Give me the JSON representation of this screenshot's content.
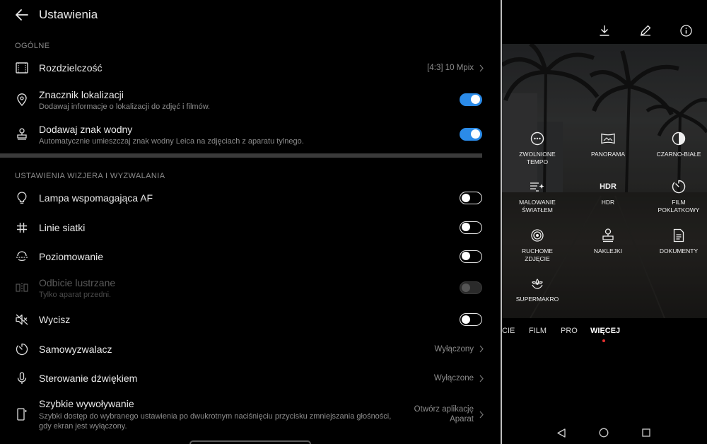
{
  "settings": {
    "title": "Ustawienia",
    "sections": {
      "general": "OGÓLNE",
      "viewfinder": "USTAWIENIA WIZJERA I WYZWALANIA"
    },
    "resolution": {
      "label": "Rozdzielczość",
      "value": "[4:3] 10 Mpix"
    },
    "location": {
      "label": "Znacznik lokalizacji",
      "sub": "Dodawaj informacje o lokalizacji do zdjęć i filmów.",
      "on": true
    },
    "watermark": {
      "label": "Dodawaj znak wodny",
      "sub": "Automatycznie umieszczaj znak wodny Leica na zdjęciach z aparatu tylnego.",
      "on": true
    },
    "af_lamp": {
      "label": "Lampa wspomagająca AF",
      "on": false
    },
    "grid": {
      "label": "Linie siatki",
      "on": false
    },
    "level": {
      "label": "Poziomowanie",
      "on": false
    },
    "mirror": {
      "label": "Odbicie lustrzane",
      "sub": "Tylko aparat przedni.",
      "on": false,
      "disabled": true
    },
    "mute": {
      "label": "Wycisz",
      "on": false
    },
    "timer": {
      "label": "Samowyzwalacz",
      "value": "Wyłączony"
    },
    "voice": {
      "label": "Sterowanie dźwiękiem",
      "value": "Wyłączone"
    },
    "quick": {
      "label": "Szybkie wywoływanie",
      "sub": "Szybki dostęp do wybranego ustawienia po dwukrotnym naciśnięciu przycisku zmniejszania głośności, gdy ekran jest wyłączony.",
      "value_line1": "Otwórz aplikację",
      "value_line2": "Aparat"
    }
  },
  "camera": {
    "top_icons": [
      "download-icon",
      "edit-icon",
      "info-icon"
    ],
    "modes": [
      {
        "name": "slow-motion",
        "label1": "ZWOLNIONE",
        "label2": "TEMPO"
      },
      {
        "name": "panorama",
        "label1": "PANORAMA",
        "label2": ""
      },
      {
        "name": "monochrome",
        "label1": "CZARNO-BIAŁE",
        "label2": ""
      },
      {
        "name": "light-painting",
        "label1": "MALOWANIE",
        "label2": "ŚWIATŁEM"
      },
      {
        "name": "hdr",
        "label1": "HDR",
        "label2": "",
        "icon_text": "HDR"
      },
      {
        "name": "time-lapse",
        "label1": "FILM",
        "label2": "POKLATKOWY"
      },
      {
        "name": "moving-picture",
        "label1": "RUCHOME",
        "label2": "ZDJĘCIE"
      },
      {
        "name": "stickers",
        "label1": "NAKLEJKI",
        "label2": ""
      },
      {
        "name": "documents",
        "label1": "DOKUMENTY",
        "label2": ""
      },
      {
        "name": "super-macro",
        "label1": "SUPERMAKRO",
        "label2": ""
      }
    ],
    "tabs": [
      "CIE",
      "FILM",
      "PRO",
      "WIĘCEJ"
    ],
    "active_tab": "WIĘCEJ",
    "accent_dot_color": "#e53030"
  },
  "colors": {
    "toggle_on": "#2b8be8",
    "background": "#000000"
  }
}
